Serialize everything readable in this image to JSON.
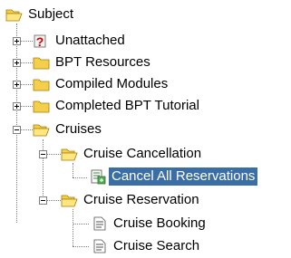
{
  "tree": {
    "root": {
      "label": "Subject",
      "icon": "open-folder-icon"
    },
    "items": [
      {
        "label": "Unattached",
        "icon": "unattached-question-icon"
      },
      {
        "label": "BPT Resources",
        "icon": "folder-icon"
      },
      {
        "label": "Compiled Modules",
        "icon": "folder-icon"
      },
      {
        "label": "Completed BPT Tutorial",
        "icon": "folder-icon"
      },
      {
        "label": "Cruises",
        "icon": "open-folder-icon"
      },
      {
        "label": "Cruise Cancellation",
        "icon": "open-folder-icon"
      },
      {
        "label": "Cancel All Reservations",
        "icon": "business-component-icon"
      },
      {
        "label": "Cruise Reservation",
        "icon": "open-folder-icon"
      },
      {
        "label": "Cruise Booking",
        "icon": "document-icon"
      },
      {
        "label": "Cruise Search",
        "icon": "document-icon"
      }
    ]
  },
  "colors": {
    "selection_bg": "#3a6ea5",
    "folder": "#f3cf4c"
  }
}
